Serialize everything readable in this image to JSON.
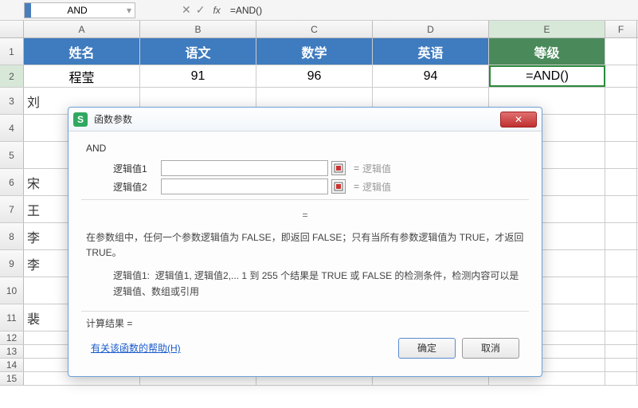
{
  "formula_bar": {
    "name_box": "AND",
    "fx_label": "fx",
    "formula": "=AND()"
  },
  "columns": [
    "A",
    "B",
    "C",
    "D",
    "E",
    "F"
  ],
  "rows": [
    "1",
    "2",
    "3",
    "4",
    "5",
    "6",
    "7",
    "8",
    "9",
    "10",
    "11",
    "12",
    "13",
    "14",
    "15"
  ],
  "headers": {
    "A": "姓名",
    "B": "语文",
    "C": "数学",
    "D": "英语",
    "E": "等级"
  },
  "data_row": {
    "A": "程莹",
    "B": "91",
    "C": "96",
    "D": "94",
    "E": "=AND()"
  },
  "partial_cells": {
    "r3": "刘",
    "r6": "宋",
    "r7": "王",
    "r8": "李",
    "r9": "李",
    "r11": "裴"
  },
  "dialog": {
    "title": "函数参数",
    "icon_letter": "S",
    "close_label": "✕",
    "fn_name": "AND",
    "args": [
      {
        "label": "逻辑值1",
        "placeholder": "逻辑值"
      },
      {
        "label": "逻辑值2",
        "placeholder": "逻辑值"
      }
    ],
    "eq_symbol": "=",
    "description": "在参数组中，任何一个参数逻辑值为 FALSE，即返回 FALSE；只有当所有参数逻辑值为 TRUE，才返回 TRUE。",
    "arg_desc_label": "逻辑值1:",
    "arg_desc": "逻辑值1, 逻辑值2,... 1 到 255 个结果是 TRUE 或 FALSE 的检测条件，检测内容可以是逻辑值、数组或引用",
    "result_label": "计算结果 =",
    "help_link": "有关该函数的帮助(H)",
    "ok": "确定",
    "cancel": "取消"
  }
}
